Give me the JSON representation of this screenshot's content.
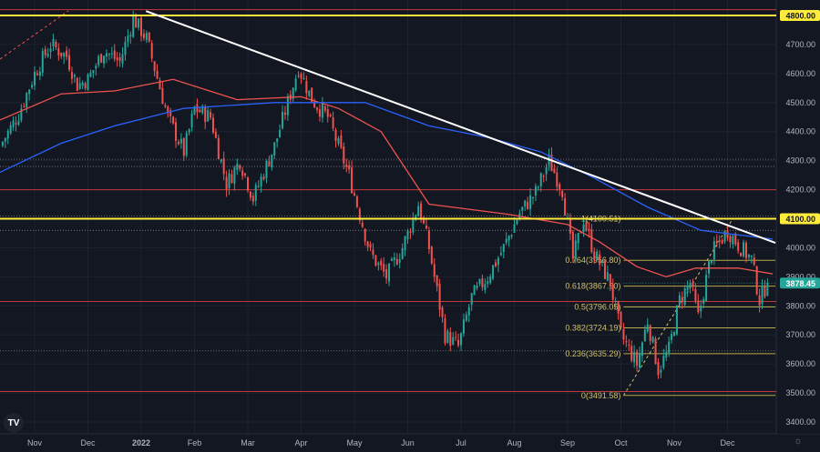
{
  "chart_data": {
    "type": "candlestick",
    "title": "",
    "x_axis": {
      "unit": "month index (0 = Nov 2021)",
      "tick_labels": [
        "Nov",
        "Dec",
        "2022",
        "Feb",
        "Mar",
        "Apr",
        "May",
        "Jun",
        "Jul",
        "Aug",
        "Sep",
        "Oct",
        "Nov",
        "Dec"
      ],
      "range": [
        -0.65,
        13.9
      ]
    },
    "y_axis": {
      "range": [
        3380,
        4840
      ],
      "tick_labels": [
        "4700.00",
        "4600.00",
        "4500.00",
        "4400.00",
        "4300.00",
        "4200.00",
        "4000.00",
        "3900.00",
        "3800.00",
        "3700.00",
        "3600.00",
        "3500.00",
        "3400.00"
      ],
      "tick_values": [
        4700,
        4600,
        4500,
        4400,
        4300,
        4200,
        4000,
        3900,
        3800,
        3700,
        3600,
        3500,
        3400
      ]
    },
    "price_path": [
      [
        -0.65,
        4350
      ],
      [
        -0.3,
        4460
      ],
      [
        0,
        4600
      ],
      [
        0.3,
        4700
      ],
      [
        0.6,
        4660
      ],
      [
        0.8,
        4560
      ],
      [
        1.0,
        4580
      ],
      [
        1.3,
        4680
      ],
      [
        1.6,
        4640
      ],
      [
        1.85,
        4790
      ],
      [
        2.1,
        4720
      ],
      [
        2.5,
        4450
      ],
      [
        2.8,
        4330
      ],
      [
        3.0,
        4480
      ],
      [
        3.3,
        4450
      ],
      [
        3.6,
        4220
      ],
      [
        3.85,
        4300
      ],
      [
        4.1,
        4170
      ],
      [
        4.5,
        4350
      ],
      [
        4.95,
        4620
      ],
      [
        5.2,
        4510
      ],
      [
        5.5,
        4450
      ],
      [
        5.9,
        4250
      ],
      [
        6.3,
        3980
      ],
      [
        6.6,
        3900
      ],
      [
        6.9,
        4000
      ],
      [
        7.2,
        4150
      ],
      [
        7.4,
        4000
      ],
      [
        7.7,
        3700
      ],
      [
        7.95,
        3660
      ],
      [
        8.2,
        3830
      ],
      [
        8.5,
        3900
      ],
      [
        8.8,
        4000
      ],
      [
        9.1,
        4120
      ],
      [
        9.4,
        4190
      ],
      [
        9.65,
        4300
      ],
      [
        9.9,
        4200
      ],
      [
        10.1,
        3960
      ],
      [
        10.3,
        4100
      ],
      [
        10.5,
        3980
      ],
      [
        10.8,
        3880
      ],
      [
        11.0,
        3700
      ],
      [
        11.3,
        3600
      ],
      [
        11.5,
        3750
      ],
      [
        11.7,
        3580
      ],
      [
        11.9,
        3650
      ],
      [
        12.1,
        3820
      ],
      [
        12.3,
        3880
      ],
      [
        12.45,
        3760
      ],
      [
        12.7,
        3980
      ],
      [
        13.0,
        4060
      ],
      [
        13.2,
        4010
      ],
      [
        13.45,
        3960
      ],
      [
        13.6,
        3820
      ],
      [
        13.75,
        3878
      ]
    ],
    "current_price": 3878.45,
    "series": [
      {
        "name": "MA red",
        "color": "#ef5350",
        "points": [
          [
            -0.65,
            4440
          ],
          [
            0.5,
            4530
          ],
          [
            1.5,
            4540
          ],
          [
            2.6,
            4580
          ],
          [
            3.8,
            4510
          ],
          [
            5.0,
            4520
          ],
          [
            5.7,
            4480
          ],
          [
            6.5,
            4400
          ],
          [
            7.4,
            4150
          ],
          [
            8.9,
            4115
          ],
          [
            10.0,
            4080
          ],
          [
            10.6,
            4020
          ],
          [
            11.3,
            3935
          ],
          [
            11.85,
            3900
          ],
          [
            12.4,
            3930
          ],
          [
            13.2,
            3930
          ],
          [
            13.85,
            3910
          ]
        ]
      },
      {
        "name": "MA blue",
        "color": "#2962ff",
        "points": [
          [
            -0.65,
            4260
          ],
          [
            0.5,
            4360
          ],
          [
            1.5,
            4420
          ],
          [
            2.8,
            4480
          ],
          [
            4.5,
            4500
          ],
          [
            6.2,
            4500
          ],
          [
            7.4,
            4420
          ],
          [
            8.5,
            4380
          ],
          [
            9.5,
            4330
          ],
          [
            10.5,
            4240
          ],
          [
            11.5,
            4140
          ],
          [
            12.5,
            4060
          ],
          [
            13.85,
            4030
          ]
        ]
      }
    ],
    "trendline": {
      "color": "#ffffff",
      "from": [
        2.09,
        4815
      ],
      "to": [
        13.9,
        4017
      ]
    },
    "horizontal_levels": {
      "yellow": [
        4800,
        4100
      ],
      "red": [
        4820,
        4200,
        3815,
        3505
      ],
      "dotted": [
        4305,
        4280,
        4110,
        4060,
        3645
      ]
    },
    "fibonacci": {
      "levels": [
        {
          "ratio": "1",
          "price": 4100.51,
          "label": "1(4100.51)"
        },
        {
          "ratio": "0.764",
          "price": 3956.8,
          "label": "0.764(3956.80)"
        },
        {
          "ratio": "0.618",
          "price": 3867.9,
          "label": "0.618(3867.90)"
        },
        {
          "ratio": "0.5",
          "price": 3796.05,
          "label": "0.5(3796.05)"
        },
        {
          "ratio": "0.382",
          "price": 3724.19,
          "label": "0.382(3724.19)"
        },
        {
          "ratio": "0.236",
          "price": 3635.29,
          "label": "0.236(3635.29)"
        },
        {
          "ratio": "0",
          "price": 3491.58,
          "label": "0(3491.58)"
        }
      ],
      "from_x": 11.05,
      "to_x": 13.9,
      "anchor_line": {
        "from": [
          11.05,
          3491.58
        ],
        "to": [
          13.1,
          4100.51
        ]
      }
    },
    "badges": [
      {
        "label": "4800.00",
        "price": 4800,
        "bg": "#ffeb3b",
        "fg": "#131722"
      },
      {
        "label": "4100.00",
        "price": 4100,
        "bg": "#ffeb3b",
        "fg": "#131722"
      },
      {
        "label": "3878.45",
        "price": 3878.45,
        "bg": "#26a69a",
        "fg": "#ffffff"
      }
    ],
    "colors": {
      "up": "#26a69a",
      "down": "#ef5350",
      "background": "#131722",
      "grid": "#1e222d"
    }
  },
  "ui": {
    "logo": "TV",
    "settings_icon": "gear-icon"
  }
}
